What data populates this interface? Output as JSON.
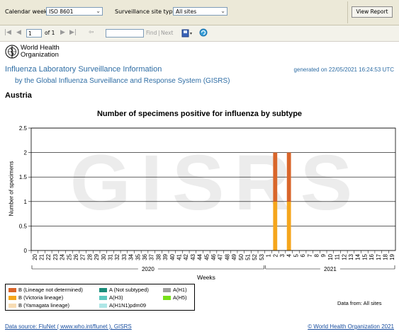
{
  "params": {
    "calendar_week_label": "Calendar week",
    "calendar_week_value": "ISO 8601",
    "site_type_label": "Surveillance site type",
    "site_type_value": "All sites",
    "view_report_label": "View Report"
  },
  "toolbar": {
    "page_value": "1",
    "page_of": "of 1",
    "find_label": "Find",
    "separator": "|",
    "next_label": "Next"
  },
  "header": {
    "org_line1": "World Health",
    "org_line2": "Organization",
    "title": "Influenza Laboratory Surveillance Information",
    "subtitle": "by the Global Influenza Surveillance and Response System (GISRS)",
    "generated": "generated on 22/05/2021 16:24:53 UTC",
    "country": "Austria"
  },
  "chart_data": {
    "type": "bar",
    "stacked": true,
    "title": "Number of specimens positive for influenza by subtype",
    "xlabel": "Weeks",
    "ylabel": "Number of specimens",
    "ylim": [
      0,
      2.5
    ],
    "yticks": [
      "0",
      "0.5",
      "1",
      "1.5",
      "2",
      "2.5"
    ],
    "watermark": "GISRS",
    "categories": [
      "20",
      "21",
      "22",
      "23",
      "24",
      "25",
      "26",
      "27",
      "28",
      "29",
      "30",
      "31",
      "32",
      "33",
      "34",
      "35",
      "36",
      "37",
      "38",
      "39",
      "40",
      "41",
      "42",
      "43",
      "44",
      "45",
      "46",
      "47",
      "48",
      "49",
      "50",
      "51",
      "52",
      "53",
      "1",
      "2",
      "3",
      "4",
      "5",
      "6",
      "7",
      "8",
      "9",
      "10",
      "11",
      "12",
      "13",
      "14",
      "15",
      "16",
      "17",
      "18",
      "19"
    ],
    "year_groups": [
      {
        "label": "2020",
        "start": 0,
        "end": 33
      },
      {
        "label": "2021",
        "start": 34,
        "end": 52
      }
    ],
    "series": [
      {
        "name": "B (Victoria lineage)",
        "color": "#f5a61c",
        "values": [
          0,
          0,
          0,
          0,
          0,
          0,
          0,
          0,
          0,
          0,
          0,
          0,
          0,
          0,
          0,
          0,
          0,
          0,
          0,
          0,
          0,
          0,
          0,
          0,
          0,
          0,
          0,
          0,
          0,
          0,
          0,
          0,
          0,
          0,
          0,
          1,
          0,
          1,
          0,
          0,
          0,
          0,
          0,
          0,
          0,
          0,
          0,
          0,
          0,
          0,
          0,
          0,
          0
        ]
      },
      {
        "name": "B (Lineage not determined)",
        "color": "#d9652a",
        "values": [
          0,
          0,
          0,
          0,
          0,
          0,
          0,
          0,
          0,
          0,
          0,
          0,
          0,
          0,
          0,
          0,
          0,
          0,
          0,
          0,
          0,
          0,
          0,
          0,
          0,
          0,
          0,
          0,
          0,
          0,
          0,
          0,
          0,
          0,
          0,
          1,
          0,
          1,
          0,
          0,
          0,
          0,
          0,
          0,
          0,
          0,
          0,
          0,
          0,
          0,
          0,
          0,
          0
        ]
      }
    ]
  },
  "legend": [
    {
      "label": "B (Lineage not determined)",
      "color": "#d9652a"
    },
    {
      "label": "B (Victoria lineage)",
      "color": "#f5a61c"
    },
    {
      "label": "B (Yamagata lineage)",
      "color": "#f7dcb4"
    },
    {
      "label": "A (Not subtyped)",
      "color": "#1a8c7a"
    },
    {
      "label": "A(H3)",
      "color": "#5cc8c0"
    },
    {
      "label": "A(H1N1)pdm09",
      "color": "#aee6e6"
    },
    {
      "label": "A(H1)",
      "color": "#a0a0a0"
    },
    {
      "label": "A(H5)",
      "color": "#77e01a"
    }
  ],
  "data_from": "Data from: All sites",
  "footer": {
    "source": "Data source: FluNet ( www.who.int/flunet ), GISRS",
    "copyright": "© World Health Organization 2021"
  }
}
